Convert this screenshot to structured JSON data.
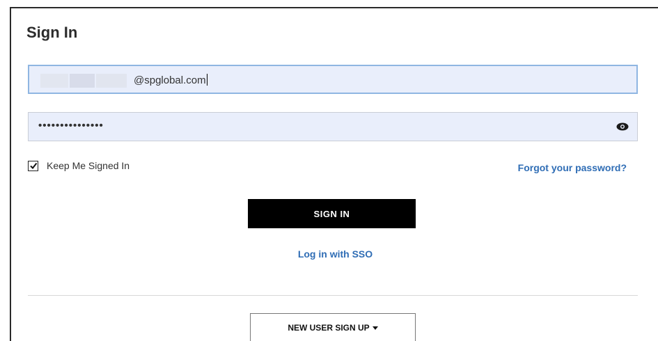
{
  "form": {
    "title": "Sign In",
    "email_value": "@spglobal.com",
    "password_value": "•••••••••••••••",
    "keep_signed_in_label": "Keep Me Signed In",
    "keep_signed_in_checked": true,
    "forgot_password_label": "Forgot your password?",
    "sign_in_label": "SIGN IN",
    "sso_label": "Log in with SSO",
    "new_user_label": "NEW USER SIGN UP"
  },
  "icons": {
    "password_toggle": "eye-icon",
    "checkbox": "checkmark-icon",
    "dropdown": "caret-down-icon"
  },
  "colors": {
    "link": "#2f6db5",
    "primary_button": "#000000",
    "input_background": "#e9eefb",
    "input_focus_border": "#8fb6e2"
  }
}
